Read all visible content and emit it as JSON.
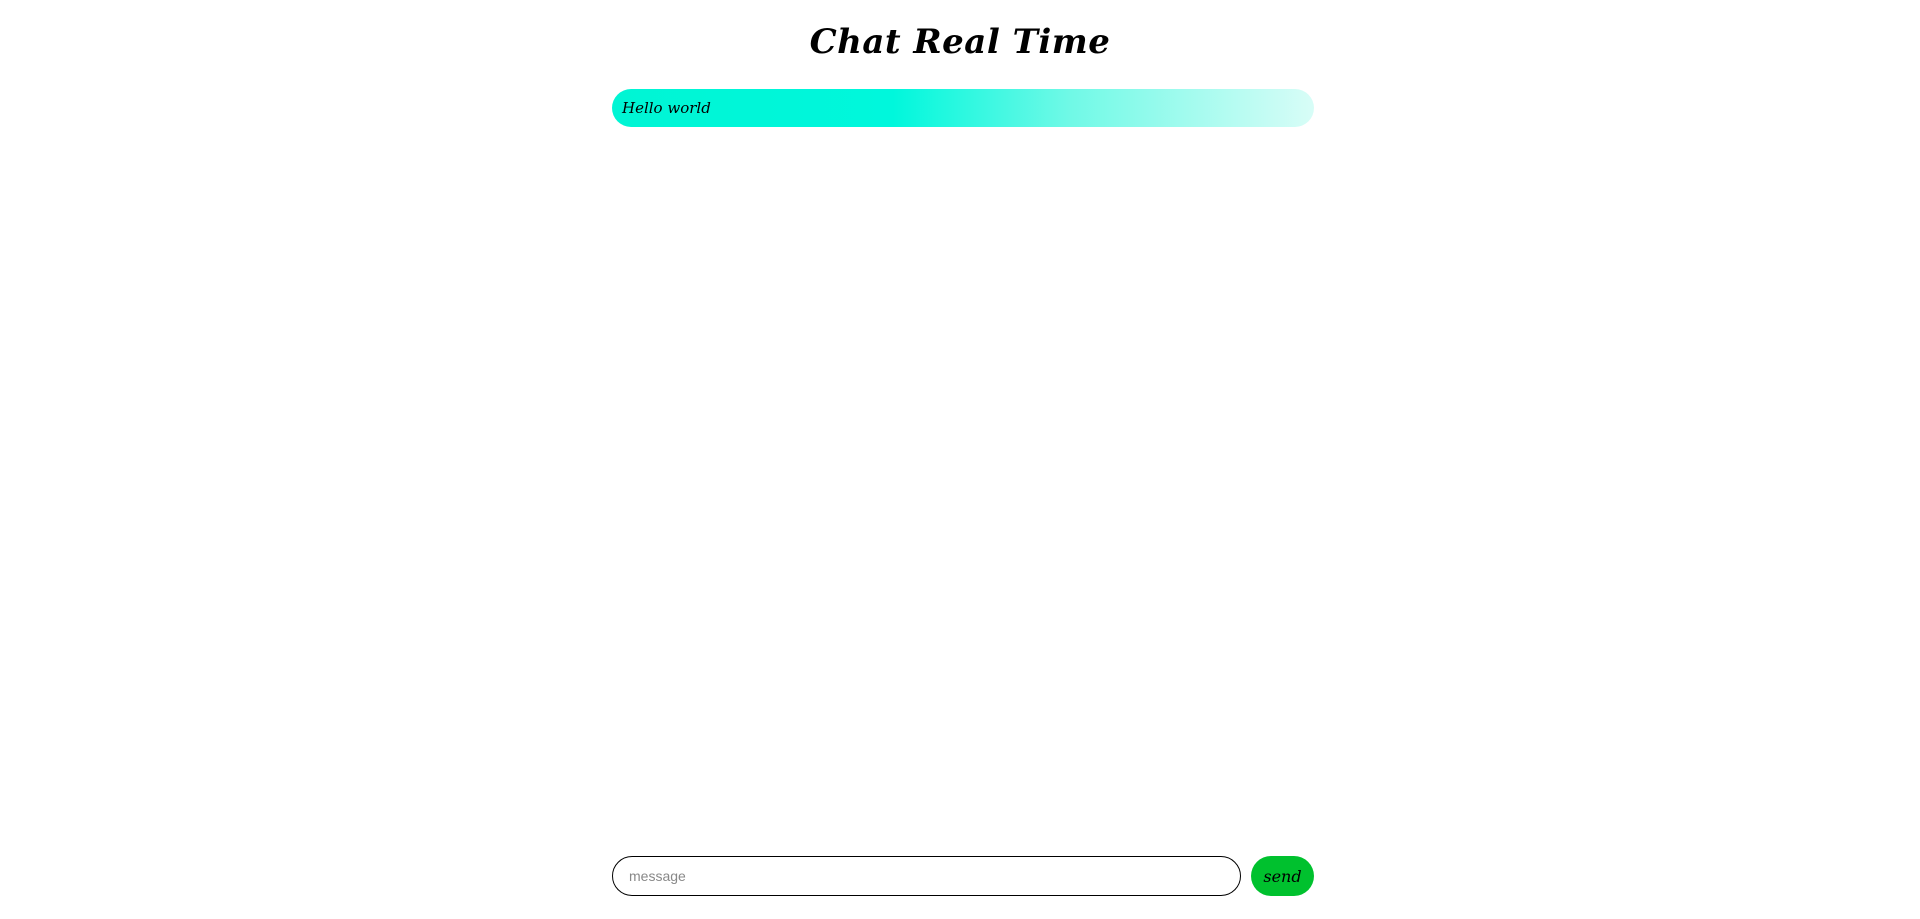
{
  "app": {
    "title": "Chat Real Time"
  },
  "messages": [
    {
      "text": "Hello world"
    }
  ],
  "composer": {
    "input_value": "",
    "placeholder": "message",
    "send_label": "send"
  },
  "colors": {
    "message_bubble_start": "#00f5d4",
    "message_bubble_end": "#d8fdf7",
    "send_button": "#00c12e"
  }
}
